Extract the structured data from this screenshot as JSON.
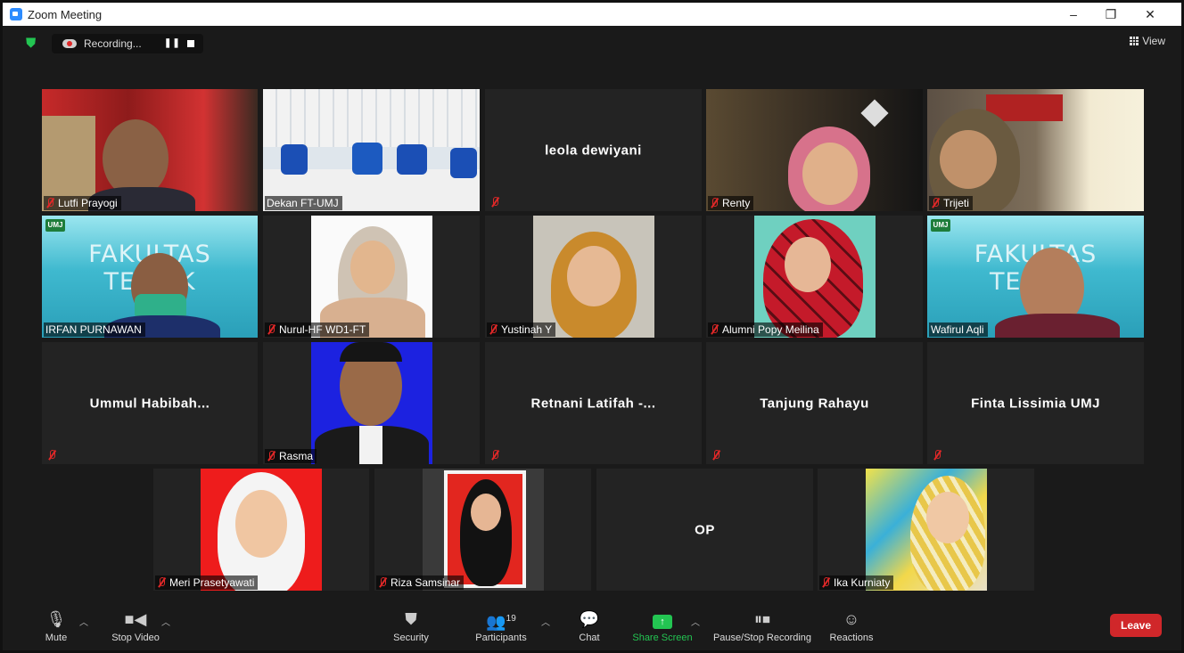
{
  "window": {
    "title": "Zoom Meeting",
    "minimize": "–",
    "restore": "❐",
    "close": "✕"
  },
  "topbar": {
    "recording_label": "Recording...",
    "pause_glyph": "❚❚",
    "view_label": "View"
  },
  "tiles": [
    {
      "name": "Lutfi Prayogi",
      "muted": true,
      "video": true
    },
    {
      "name": "Dekan FT-UMJ",
      "muted": false,
      "video": true
    },
    {
      "name": "leola dewiyani",
      "muted": true,
      "video": false
    },
    {
      "name": "Renty",
      "muted": true,
      "video": true
    },
    {
      "name": "Trijeti",
      "muted": true,
      "video": true
    },
    {
      "name": "IRFAN PURNAWAN",
      "muted": false,
      "video": true
    },
    {
      "name": "Nurul-HF WD1-FT",
      "muted": true,
      "video": true
    },
    {
      "name": "Yustinah Y",
      "muted": true,
      "video": true
    },
    {
      "name": "Alumni Popy Meilina",
      "muted": true,
      "video": true
    },
    {
      "name": "Wafirul Aqli",
      "muted": false,
      "video": true,
      "active_speaker": true
    },
    {
      "name": "Ummul  Habibah...",
      "muted": true,
      "video": false
    },
    {
      "name": "Rasma",
      "muted": true,
      "video": true
    },
    {
      "name": "Retnani  Latifah  -...",
      "muted": true,
      "video": false
    },
    {
      "name": "Tanjung Rahayu",
      "muted": true,
      "video": false
    },
    {
      "name": "Finta Lissimia UMJ",
      "muted": true,
      "video": false
    },
    {
      "name": "Meri Prasetyawati",
      "muted": true,
      "video": true
    },
    {
      "name": "Riza Samsinar",
      "muted": true,
      "video": true
    },
    {
      "name": "OP",
      "muted": false,
      "video": false
    },
    {
      "name": "Ika Kurniaty",
      "muted": true,
      "video": true
    }
  ],
  "banner": {
    "text": "FAKULTAS TEKNIK",
    "logo": "UMJ"
  },
  "toolbar": {
    "mute": "Mute",
    "stop_video": "Stop Video",
    "security": "Security",
    "participants": "Participants",
    "participants_count": "19",
    "chat": "Chat",
    "share_screen": "Share Screen",
    "pause_stop_recording": "Pause/Stop Recording",
    "reactions": "Reactions",
    "leave": "Leave"
  },
  "colors": {
    "accent_green": "#23c552",
    "leave_red": "#d0272a",
    "active_speaker": "#e6e34a",
    "muted_red": "#e02828"
  }
}
